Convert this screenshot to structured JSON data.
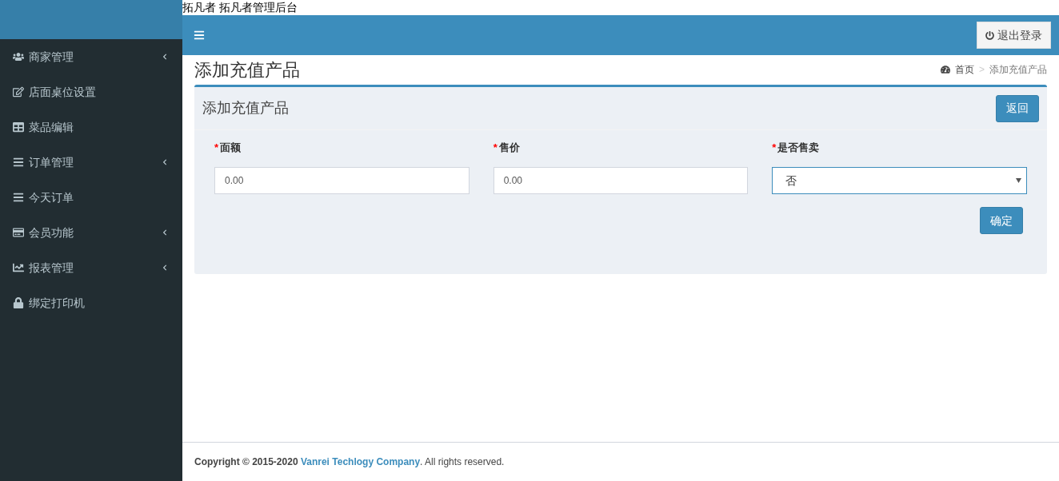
{
  "page_title_text": "拓凡者 拓凡者管理后台",
  "sidebar": {
    "items": [
      {
        "label": "商家管理",
        "expandable": true
      },
      {
        "label": "店面桌位设置",
        "expandable": false
      },
      {
        "label": "菜品编辑",
        "expandable": false
      },
      {
        "label": "订单管理",
        "expandable": true
      },
      {
        "label": "今天订单",
        "expandable": false
      },
      {
        "label": "会员功能",
        "expandable": true
      },
      {
        "label": "报表管理",
        "expandable": true
      },
      {
        "label": "绑定打印机",
        "expandable": false
      }
    ]
  },
  "header": {
    "logout": "退出登录"
  },
  "content": {
    "title": "添加充值产品",
    "breadcrumb": [
      "首页",
      "添加充值产品"
    ],
    "separator": ">"
  },
  "box": {
    "title": "添加充值产品",
    "back": "返回",
    "fields": [
      {
        "kind": "input",
        "required_mark": "*",
        "label": "面额",
        "value": "0.00"
      },
      {
        "kind": "input",
        "required_mark": "*",
        "label": "售价",
        "value": "0.00"
      },
      {
        "kind": "select",
        "required_mark": "*",
        "label": "是否售卖",
        "value": "否"
      }
    ],
    "submit": "确定"
  },
  "footer": {
    "prefix": "Copyright © 2015-2020",
    "link": "Vanrei Techlogy Company",
    "suffix": ". All rights reserved."
  }
}
